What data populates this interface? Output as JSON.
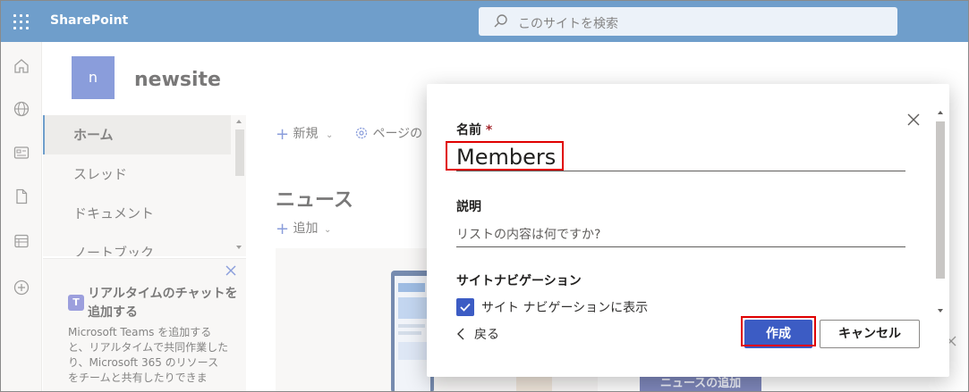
{
  "suitebar": {
    "brand": "SharePoint",
    "search_placeholder": "このサイトを検索"
  },
  "rail": {
    "icons": [
      "home-icon",
      "globe-icon",
      "news-icon",
      "file-icon",
      "lists-icon",
      "create-icon"
    ]
  },
  "site": {
    "logo_letter": "n",
    "title": "newsite"
  },
  "nav": {
    "items": [
      {
        "label": "ホーム",
        "selected": true
      },
      {
        "label": "スレッド"
      },
      {
        "label": "ドキュメント"
      },
      {
        "label": "ノートブック"
      }
    ]
  },
  "promo": {
    "icon_letter": "T",
    "title": "リアルタイムのチャットを追加する",
    "body": "Microsoft Teams を追加すると、リアルタイムで共同作業したり、Microsoft 365 のリソースをチームと共有したりできま"
  },
  "main": {
    "new_label": "新規",
    "page_label": "ページの",
    "news_heading": "ニュース",
    "add_label": "追加",
    "news_add_button": "ニュースの追加"
  },
  "dialog": {
    "name_label": "名前",
    "required_mark": "*",
    "name_value": "Members",
    "desc_label": "説明",
    "desc_placeholder": "リストの内容は何ですか?",
    "nav_label": "サイトナビゲーション",
    "checkbox_label": "サイト ナビゲーションに表示",
    "checkbox_checked": true,
    "back_label": "戻る",
    "create_label": "作成",
    "cancel_label": "キャンセル"
  },
  "colors": {
    "suitebar": "#0f5ea8",
    "accent": "#3c5cc4",
    "highlight": "#e00000"
  }
}
